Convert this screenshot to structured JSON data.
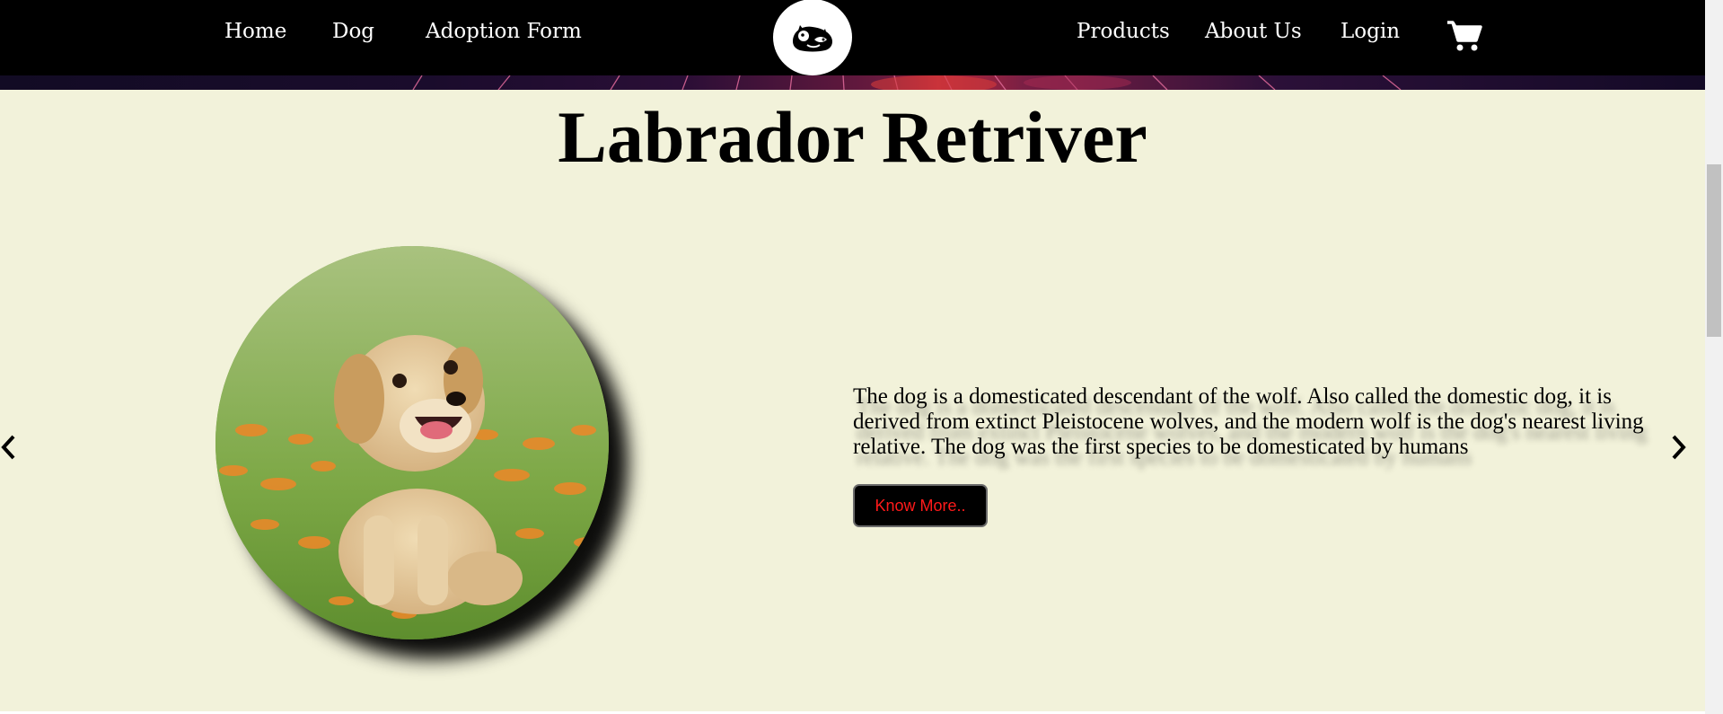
{
  "nav": {
    "left_items": [
      "Home",
      "Dog",
      "Adoption Form"
    ],
    "right_items": [
      "Products",
      "About Us",
      "Login"
    ],
    "logo_icon": "pets-logo-icon",
    "cart_icon": "shopping-cart-icon"
  },
  "hero": {
    "title": "Labrador Retriver",
    "description": "The dog is a domesticated descendant of the wolf. Also called the domestic dog, it is derived from extinct Pleistocene wolves, and the modern wolf is the dog's nearest living relative. The dog was the first species to be domesticated by humans",
    "button_label": "Know More..",
    "prev_icon": "chevron-left-icon",
    "next_icon": "chevron-right-icon"
  },
  "colors": {
    "nav_bg": "#000000",
    "content_bg": "#f2f2da",
    "button_text": "#ff1a1a",
    "text": "#000000"
  }
}
